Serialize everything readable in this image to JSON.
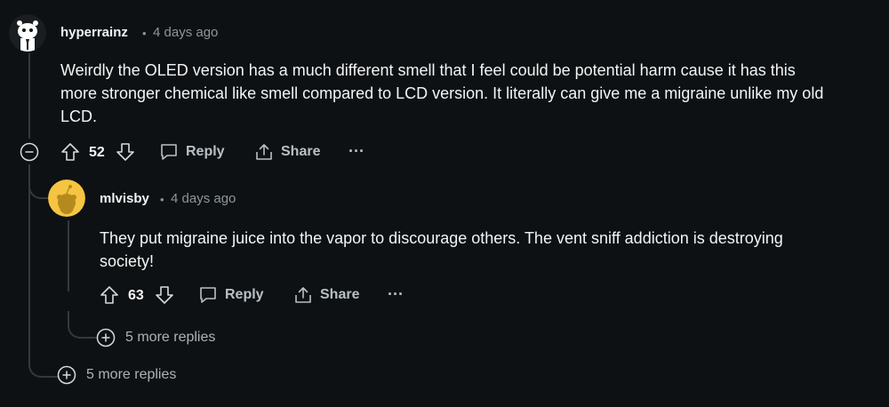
{
  "comments": [
    {
      "username": "hyperrainz",
      "separator": "•",
      "time": "4 days ago",
      "body_lines": [
        "Weirdly the OLED version has a much different smell that I feel could be potential harm cause it has this",
        "more stronger chemical like smell compared to LCD version. It literally can give me a migraine unlike my old",
        "LCD."
      ],
      "votes": "52",
      "reply_label": "Reply",
      "share_label": "Share",
      "more_label": "···",
      "more_replies": "5 more replies"
    },
    {
      "username": "mlvisby",
      "separator": "•",
      "time": "4 days ago",
      "body_lines": [
        "They put migraine juice into the vapor to discourage others. The vent sniff addiction is destroying",
        "society!"
      ],
      "votes": "63",
      "reply_label": "Reply",
      "share_label": "Share",
      "more_label": "···",
      "more_replies": "5 more replies"
    }
  ],
  "colors": {
    "background": "#0e1113",
    "thread_line": "#33393d",
    "avatar2": "#f5c542"
  },
  "icons": {
    "upvote": "arrow-up-icon",
    "downvote": "arrow-down-icon",
    "reply": "comment-bubble-icon",
    "share": "share-icon",
    "collapse": "minus-circle-icon",
    "expand": "plus-circle-icon"
  }
}
